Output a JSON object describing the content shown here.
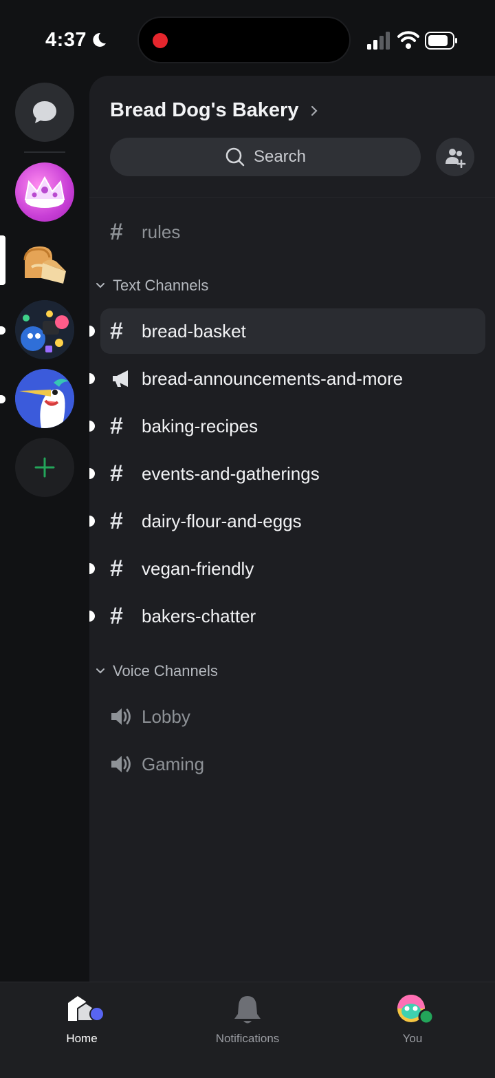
{
  "status_bar": {
    "time": "4:37"
  },
  "server": {
    "name": "Bread Dog's Bakery"
  },
  "search": {
    "label": "Search"
  },
  "top_channel": {
    "name": "rules"
  },
  "text_category": {
    "label": "Text Channels"
  },
  "text_channels": [
    {
      "name": "bread-basket",
      "icon": "hash-icon",
      "selected": true
    },
    {
      "name": "bread-announcements-and-more",
      "icon": "megaphone-icon"
    },
    {
      "name": "baking-recipes",
      "icon": "hash-icon"
    },
    {
      "name": "events-and-gatherings",
      "icon": "hash-icon"
    },
    {
      "name": "dairy-flour-and-eggs",
      "icon": "hash-icon"
    },
    {
      "name": "vegan-friendly",
      "icon": "hash-icon"
    },
    {
      "name": "bakers-chatter",
      "icon": "hash-icon"
    }
  ],
  "voice_category": {
    "label": "Voice Channels"
  },
  "voice_channels": [
    {
      "name": "Lobby",
      "icon": "speaker-icon"
    },
    {
      "name": "Gaming",
      "icon": "speaker-icon"
    }
  ],
  "nav": {
    "home": "Home",
    "notifications": "Notifications",
    "you": "You"
  },
  "colors": {
    "accent": "#5865f2",
    "online": "#23a55a",
    "add_server": "#23a55a",
    "recording": "#e5262d"
  }
}
